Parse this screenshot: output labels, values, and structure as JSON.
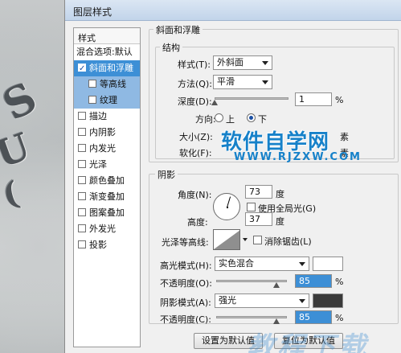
{
  "window": {
    "title": "图层样式"
  },
  "style_list": {
    "header": "样式",
    "items": [
      {
        "label": "混合选项:默认",
        "checkbox": false,
        "checked": false,
        "kind": "plain"
      },
      {
        "label": "斜面和浮雕",
        "checkbox": true,
        "checked": true,
        "kind": "selected"
      },
      {
        "label": "等高线",
        "checkbox": true,
        "checked": false,
        "kind": "sub"
      },
      {
        "label": "纹理",
        "checkbox": true,
        "checked": false,
        "kind": "sub"
      },
      {
        "label": "描边",
        "checkbox": true,
        "checked": false,
        "kind": "normal"
      },
      {
        "label": "内阴影",
        "checkbox": true,
        "checked": false,
        "kind": "normal"
      },
      {
        "label": "内发光",
        "checkbox": true,
        "checked": false,
        "kind": "normal"
      },
      {
        "label": "光泽",
        "checkbox": true,
        "checked": false,
        "kind": "normal"
      },
      {
        "label": "颜色叠加",
        "checkbox": true,
        "checked": false,
        "kind": "normal"
      },
      {
        "label": "渐变叠加",
        "checkbox": true,
        "checked": false,
        "kind": "normal"
      },
      {
        "label": "图案叠加",
        "checkbox": true,
        "checked": false,
        "kind": "normal"
      },
      {
        "label": "外发光",
        "checkbox": true,
        "checked": false,
        "kind": "normal"
      },
      {
        "label": "投影",
        "checkbox": true,
        "checked": false,
        "kind": "normal"
      }
    ]
  },
  "bevel": {
    "section_title": "斜面和浮雕",
    "structure_title": "结构",
    "style_label": "样式(T):",
    "style_value": "外斜面",
    "technique_label": "方法(Q):",
    "technique_value": "平滑",
    "depth_label": "深度(D):",
    "depth_value": "1",
    "depth_fraction": 0.0,
    "percent": "%",
    "direction_label": "方向:",
    "direction_up": "上",
    "direction_down": "下",
    "direction_selected": "down",
    "size_label": "大小(Z):",
    "size_unit_partial": "素",
    "soften_label": "软化(F):",
    "soften_unit_partial": "素"
  },
  "shading": {
    "title": "阴影",
    "angle_label": "角度(N):",
    "angle_value": "73",
    "degree": "度",
    "global_light_label": "使用全局光(G)",
    "altitude_label": "高度:",
    "altitude_value": "37",
    "gloss_contour_label": "光泽等高线:",
    "anti_alias_label": "消除锯齿(L)",
    "highlight_mode_label": "高光模式(H):",
    "highlight_mode_value": "实色混合",
    "highlight_color": "#ffffff",
    "highlight_opacity_label": "不透明度(O):",
    "highlight_opacity_value": "85",
    "highlight_opacity_fraction": 0.85,
    "shadow_mode_label": "阴影模式(A):",
    "shadow_mode_value": "强光",
    "shadow_color": "#3a3a3a",
    "shadow_opacity_label": "不透明度(C):",
    "shadow_opacity_value": "85",
    "shadow_opacity_fraction": 0.85
  },
  "buttons": {
    "make_default": "设置为默认值",
    "reset_default": "复位为默认值"
  },
  "watermark": {
    "site_name": "软件自学网",
    "site_url": "WWW.RJZXW.COM",
    "bottom_mark": "教程下载"
  },
  "colors": {
    "accent": "#3d8fd6",
    "sub_row": "#8fb9e3",
    "watermark_blue": "#1681c9"
  }
}
